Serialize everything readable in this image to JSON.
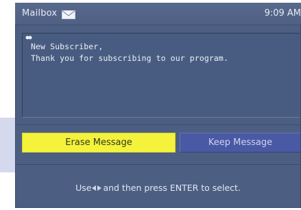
{
  "header": {
    "title": "Mailbox",
    "envelope_icon": "envelope-icon",
    "time": "9:09 AM"
  },
  "message": {
    "lines": [
      "New Subscriber,",
      "Thank you for subscribing to our program."
    ]
  },
  "buttons": {
    "erase_label": "Erase Message",
    "keep_label": "Keep Message"
  },
  "footer": {
    "hint_before": "Use",
    "hint_after": "and then press ENTER to select.",
    "arrows_icon": "left-right-arrows-icon"
  },
  "colors": {
    "screen_bg": "#4c5f82",
    "selected_button": "#f4f23a",
    "unselected_button": "#4a59a4"
  }
}
